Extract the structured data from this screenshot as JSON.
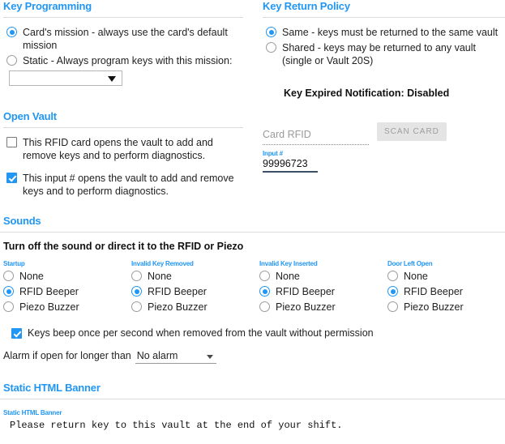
{
  "key_programming": {
    "title": "Key Programming",
    "options": [
      {
        "label": "Card's mission - always use the card's default mission",
        "selected": true
      },
      {
        "label": "Static - Always program keys with this mission:",
        "selected": false
      }
    ],
    "mission_select": {
      "value": "",
      "placeholder": ""
    }
  },
  "key_return_policy": {
    "title": "Key Return Policy",
    "options": [
      {
        "label": "Same - keys must be returned to the same vault",
        "selected": true
      },
      {
        "label": "Shared - keys may be returned to any vault (single or Vault 20S)",
        "selected": false
      }
    ],
    "key_expired_notification": "Key Expired Notification: Disabled"
  },
  "open_vault": {
    "title": "Open Vault",
    "checkboxes": [
      {
        "label": "This RFID card opens the vault to add and remove keys and to perform diagnostics.",
        "checked": false
      },
      {
        "label": "This input # opens the vault to add and remove keys and to perform diagnostics.",
        "checked": true
      }
    ],
    "card_rfid": {
      "placeholder": "Card RFID",
      "value": ""
    },
    "input_number": {
      "mini_label": "Input #",
      "value": "99996723"
    },
    "scan_card_button": "SCAN CARD"
  },
  "sounds": {
    "title": "Sounds",
    "intro": "Turn off the sound or direct it to the RFID or Piezo",
    "groups": [
      {
        "name": "Startup",
        "options": [
          "None",
          "RFID Beeper",
          "Piezo Buzzer"
        ],
        "selected": 1
      },
      {
        "name": "Invalid Key Removed",
        "options": [
          "None",
          "RFID Beeper",
          "Piezo Buzzer"
        ],
        "selected": 1
      },
      {
        "name": "Invalid Key Inserted",
        "options": [
          "None",
          "RFID Beeper",
          "Piezo Buzzer"
        ],
        "selected": 1
      },
      {
        "name": "Door Left Open",
        "options": [
          "None",
          "RFID Beeper",
          "Piezo Buzzer"
        ],
        "selected": 1
      }
    ],
    "beep_checkbox": {
      "label": "Keys beep once per second when removed from the vault without permission",
      "checked": true
    },
    "alarm": {
      "label": "Alarm if open for longer than",
      "value": "No alarm"
    }
  },
  "static_html_banner": {
    "title": "Static HTML Banner",
    "mini_label": "Static HTML Banner",
    "value": "Please return key to this vault at the end of your shift."
  },
  "colors": {
    "accent": "#2196f3",
    "rule": "#dcdcdc",
    "text": "#222222",
    "underline_dark": "#3c5068",
    "button_bg": "#e4e4e4",
    "button_text": "#9d9d9d"
  }
}
